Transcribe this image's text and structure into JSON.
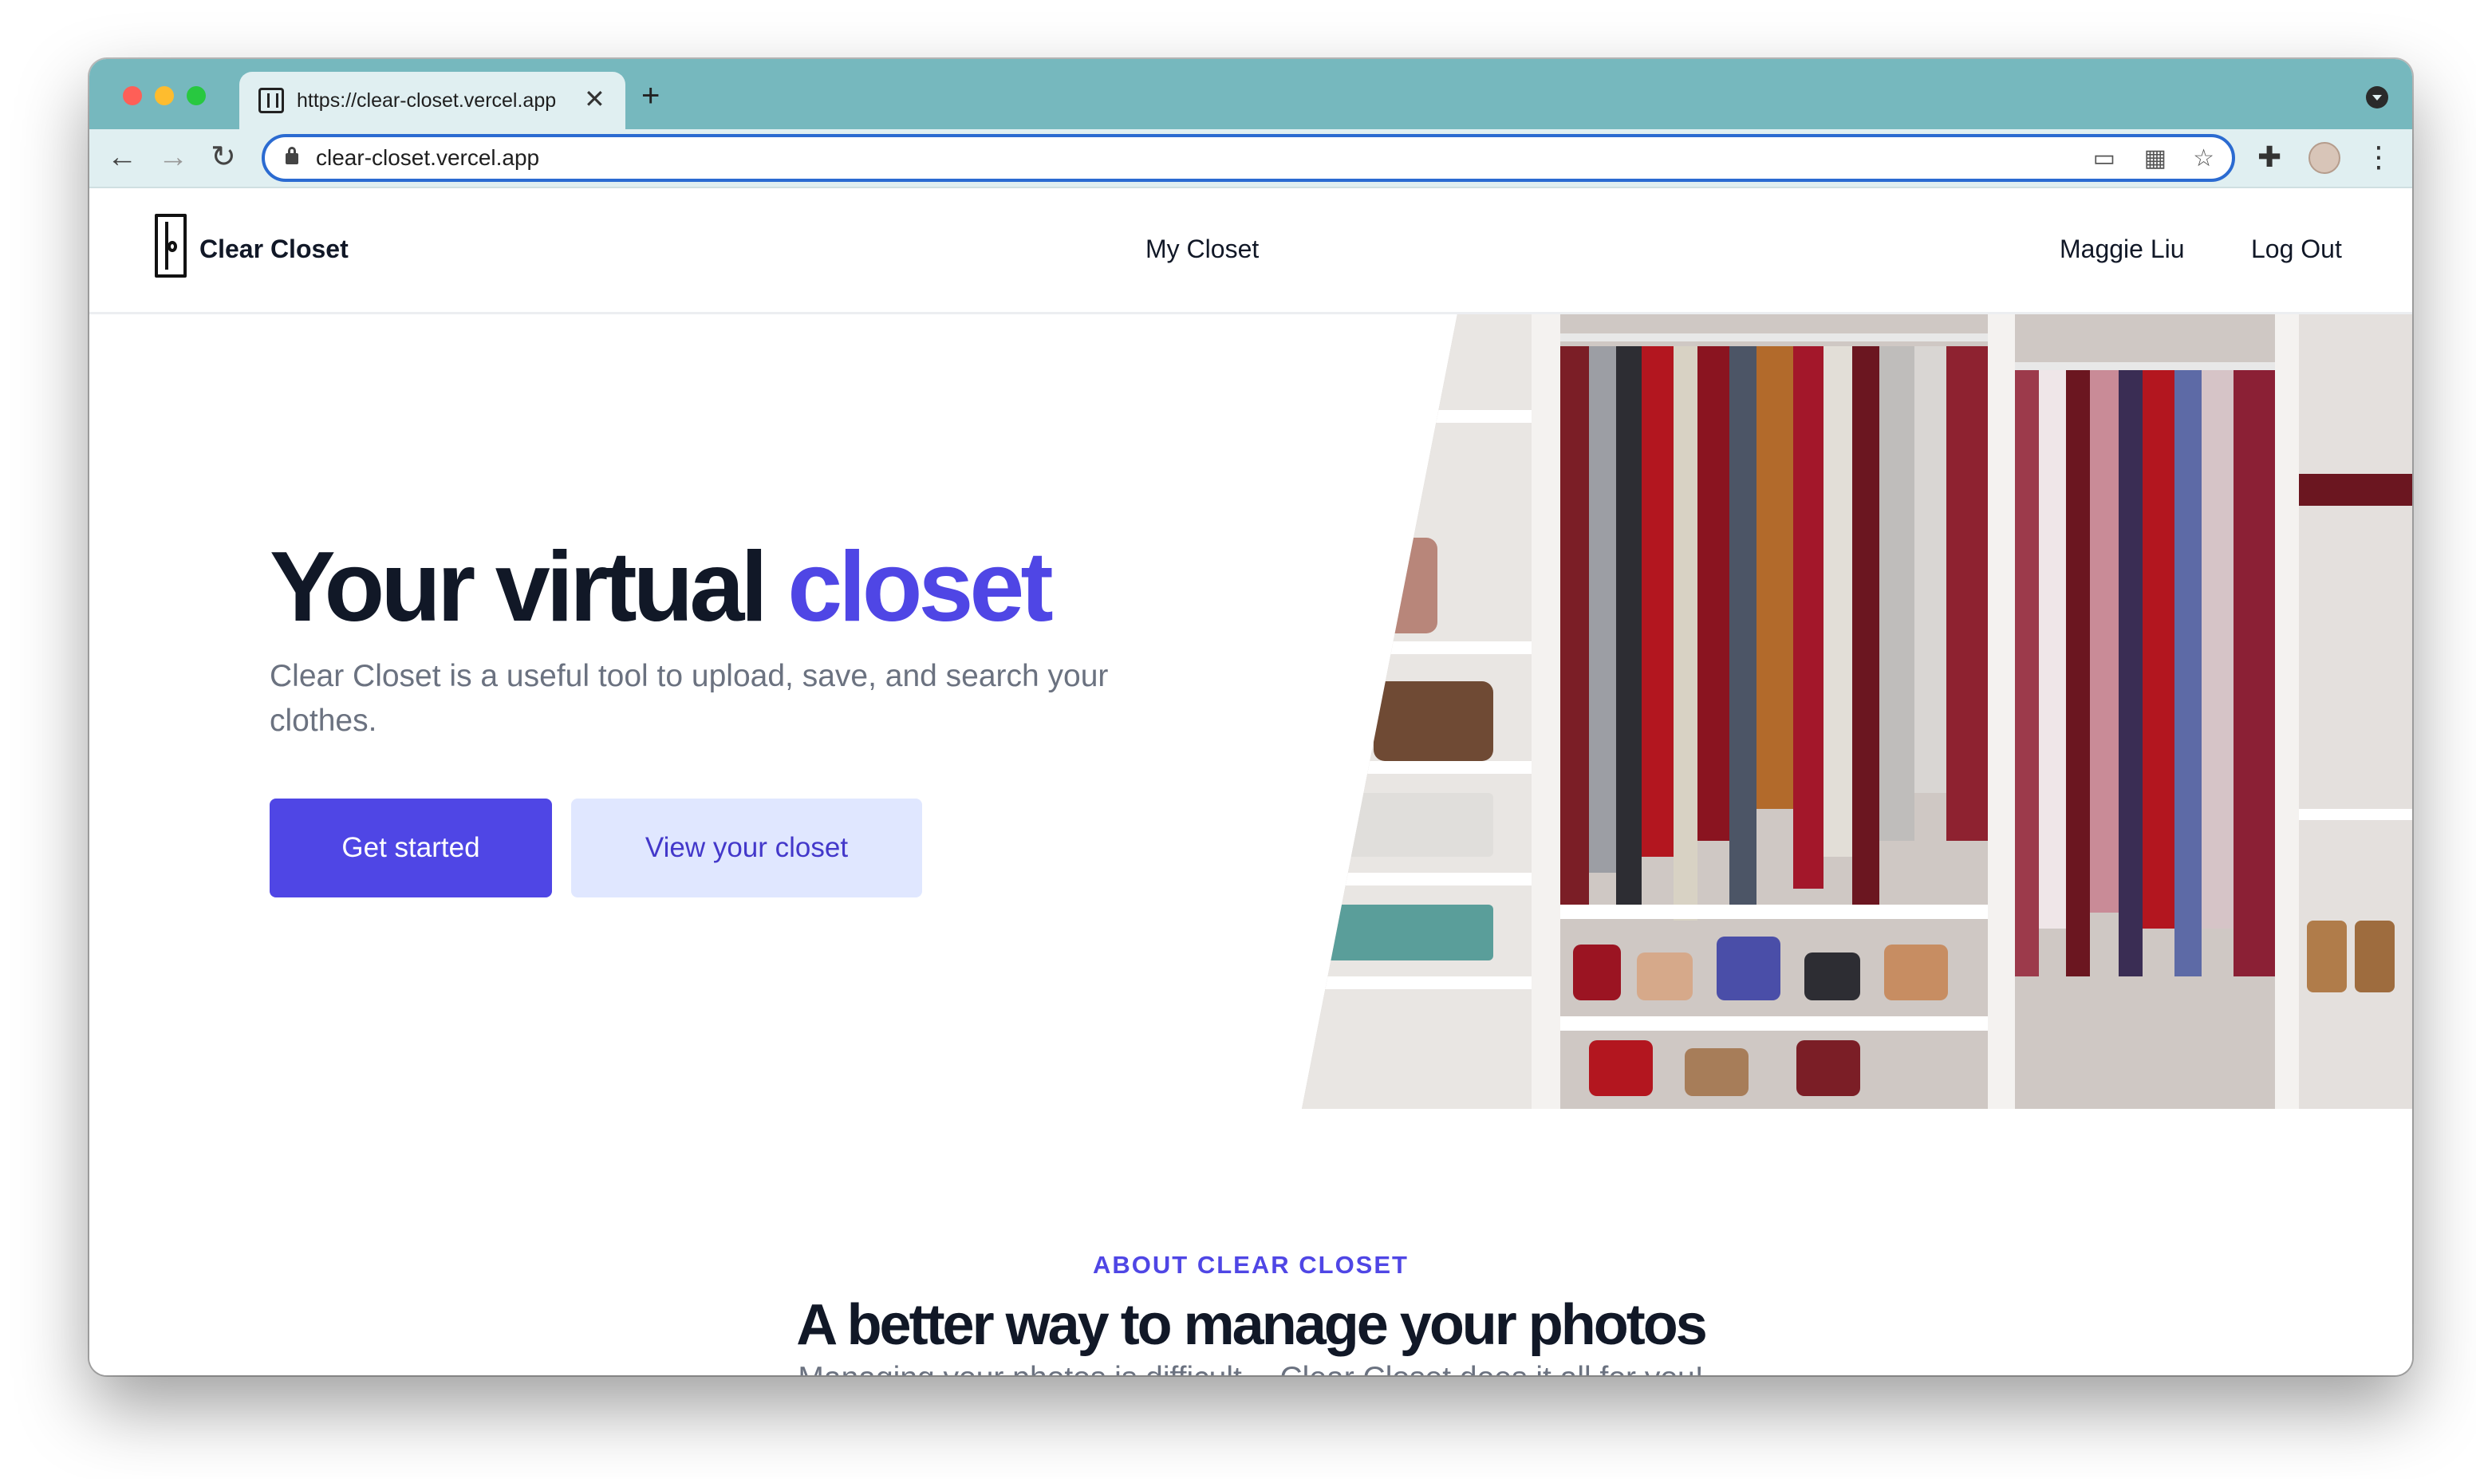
{
  "browser": {
    "tab_title": "https://clear-closet.vercel.app",
    "tab_close": "✕",
    "new_tab": "+",
    "url": "clear-closet.vercel.app",
    "icons": {
      "back": "←",
      "forward": "→",
      "reload": "↻",
      "cast": "▭",
      "qr": "▦",
      "star": "☆",
      "extensions": "✚",
      "more": "⋮"
    }
  },
  "header": {
    "logo_text": "Clear Closet",
    "nav_link": "My Closet",
    "user_name": "Maggie Liu",
    "logout": "Log Out"
  },
  "hero": {
    "title_main": "Your virtual ",
    "title_accent": "closet",
    "subtitle": "Clear Closet is a useful tool to upload, save, and search your clothes.",
    "primary_button": "Get started",
    "secondary_button": "View your closet"
  },
  "about": {
    "kicker": "ABOUT CLEAR CLOSET",
    "title": "A better way to manage your photos",
    "subtitle": "Managing your photos is difficult -- Clear Closet does it all for you!"
  },
  "colors": {
    "accent": "#4f46e5",
    "accent_light": "#e0e7ff",
    "tab_bar": "#76b8be",
    "heading": "#111827",
    "muted": "#6b7280"
  }
}
